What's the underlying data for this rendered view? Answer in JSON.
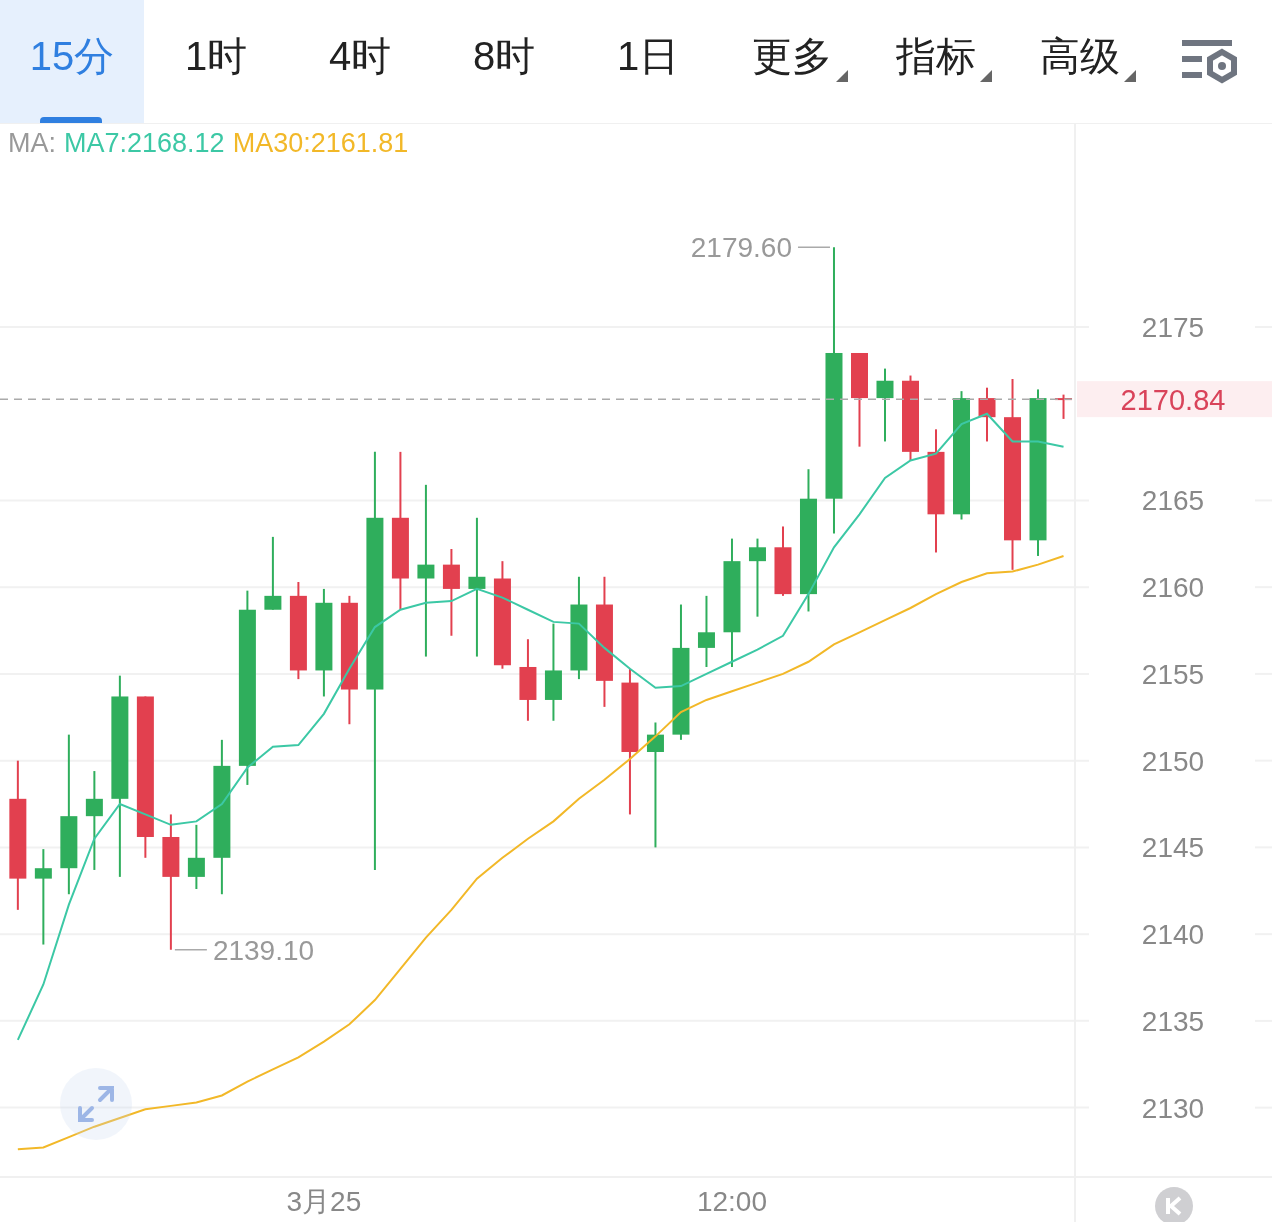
{
  "tabs": [
    {
      "label": "15分",
      "selected": true,
      "dropdown": false
    },
    {
      "label": "1时",
      "selected": false,
      "dropdown": false
    },
    {
      "label": "4时",
      "selected": false,
      "dropdown": false
    },
    {
      "label": "8时",
      "selected": false,
      "dropdown": false
    },
    {
      "label": "1日",
      "selected": false,
      "dropdown": false
    },
    {
      "label": "更多",
      "selected": false,
      "dropdown": true
    },
    {
      "label": "指标",
      "selected": false,
      "dropdown": true
    },
    {
      "label": "高级",
      "selected": false,
      "dropdown": true
    }
  ],
  "legend": {
    "prefix": "MA:",
    "items": [
      {
        "label": "MA7:2168.12",
        "color": "#3cc8a5"
      },
      {
        "label": "MA30:2161.81",
        "color": "#f2b828"
      }
    ]
  },
  "chart": {
    "chart_data": {
      "type": "line",
      "grid": true,
      "ylim": [
        2126.0,
        2186.7
      ],
      "yticks": [
        2130,
        2135,
        2140,
        2145,
        2150,
        2155,
        2160,
        2165,
        2175
      ],
      "categories": [
        null,
        null,
        null,
        null,
        null,
        null,
        null,
        null,
        null,
        null,
        null,
        null,
        "3月25",
        null,
        null,
        null,
        null,
        null,
        null,
        null,
        null,
        null,
        null,
        null,
        null,
        null,
        null,
        null,
        "12:00",
        null,
        null,
        null,
        null,
        null,
        null,
        null,
        null,
        null,
        null,
        null,
        null,
        null
      ],
      "series": [
        {
          "color": "#3cc8a5",
          "values": [
            2133.9,
            2137.1,
            2141.7,
            2145.5,
            2147.5,
            2146.9,
            2146.3,
            2146.5,
            2147.5,
            2149.6,
            2150.8,
            2150.9,
            2152.7,
            2155.3,
            2157.7,
            2158.7,
            2159.1,
            2159.2,
            2159.9,
            2159.4,
            2158.7,
            2158.0,
            2157.9,
            2156.5,
            2155.3,
            2154.2,
            2154.3,
            2155.0,
            2155.7,
            2156.4,
            2157.2,
            2159.6,
            2162.3,
            2164.2,
            2166.3,
            2167.3,
            2167.7,
            2169.4,
            2170.0,
            2168.4,
            2168.4,
            2168.1
          ]
        },
        {
          "color": "#f2b828",
          "values": [
            2127.6,
            2127.7,
            2128.3,
            2128.9,
            2129.4,
            2129.9,
            2130.1,
            2130.3,
            2130.7,
            2131.5,
            2132.2,
            2132.9,
            2133.8,
            2134.8,
            2136.2,
            2138.0,
            2139.8,
            2141.4,
            2143.2,
            2144.4,
            2145.5,
            2146.5,
            2147.8,
            2148.9,
            2150.1,
            2151.4,
            2152.8,
            2153.5,
            2154.0,
            2154.5,
            2155.0,
            2155.7,
            2156.7,
            2157.4,
            2158.1,
            2158.8,
            2159.6,
            2160.3,
            2160.8,
            2160.9,
            2161.3,
            2161.8
          ]
        },
        {
          "type": "candlestick",
          "ohlc": [
            [
              2147.8,
              2150.0,
              2141.4,
              2143.2
            ],
            [
              2143.2,
              2144.9,
              2139.4,
              2143.8
            ],
            [
              2143.8,
              2151.5,
              2142.3,
              2146.8
            ],
            [
              2146.8,
              2149.4,
              2143.7,
              2147.8
            ],
            [
              2147.8,
              2154.9,
              2143.3,
              2153.7
            ],
            [
              2153.7,
              2153.7,
              2144.4,
              2145.6
            ],
            [
              2145.6,
              2146.9,
              2139.1,
              2143.3
            ],
            [
              2143.3,
              2146.3,
              2142.6,
              2144.4
            ],
            [
              2144.4,
              2151.2,
              2142.3,
              2149.7
            ],
            [
              2149.7,
              2159.8,
              2148.6,
              2158.7
            ],
            [
              2158.7,
              2162.9,
              2158.7,
              2159.5
            ],
            [
              2159.5,
              2160.3,
              2154.7,
              2155.2
            ],
            [
              2155.2,
              2159.9,
              2153.7,
              2159.1
            ],
            [
              2159.1,
              2159.5,
              2152.1,
              2154.1
            ],
            [
              2154.1,
              2167.8,
              2143.7,
              2164.0
            ],
            [
              2164.0,
              2167.8,
              2158.7,
              2160.5
            ],
            [
              2160.5,
              2165.9,
              2156.0,
              2161.3
            ],
            [
              2161.3,
              2162.2,
              2157.2,
              2159.9
            ],
            [
              2159.9,
              2164.0,
              2156.0,
              2160.6
            ],
            [
              2160.5,
              2161.5,
              2155.3,
              2155.5
            ],
            [
              2155.4,
              2157.0,
              2152.3,
              2153.5
            ],
            [
              2153.5,
              2157.9,
              2152.3,
              2155.2
            ],
            [
              2155.2,
              2160.6,
              2154.7,
              2159.0
            ],
            [
              2159.0,
              2160.6,
              2153.1,
              2154.6
            ],
            [
              2154.5,
              2155.3,
              2146.9,
              2150.5
            ],
            [
              2150.5,
              2152.2,
              2145.0,
              2151.5
            ],
            [
              2151.5,
              2159.0,
              2151.2,
              2156.5
            ],
            [
              2156.5,
              2159.5,
              2155.4,
              2157.4
            ],
            [
              2157.4,
              2162.8,
              2155.4,
              2161.5
            ],
            [
              2161.5,
              2162.8,
              2158.3,
              2162.3
            ],
            [
              2162.3,
              2163.5,
              2159.5,
              2159.6
            ],
            [
              2159.6,
              2166.8,
              2158.6,
              2165.1
            ],
            [
              2165.1,
              2179.6,
              2163.1,
              2173.5
            ],
            [
              2173.5,
              2173.5,
              2168.1,
              2170.9
            ],
            [
              2170.9,
              2172.6,
              2168.4,
              2171.9
            ],
            [
              2171.9,
              2172.2,
              2167.3,
              2167.8
            ],
            [
              2167.8,
              2169.1,
              2162.0,
              2164.2
            ],
            [
              2164.2,
              2171.3,
              2163.9,
              2170.9
            ],
            [
              2170.9,
              2171.5,
              2168.4,
              2169.8
            ],
            [
              2169.8,
              2172.0,
              2161.0,
              2162.7
            ],
            [
              2162.7,
              2171.4,
              2161.8,
              2170.9
            ],
            [
              2170.9,
              2171.1,
              2169.7,
              2170.84
            ]
          ]
        }
      ],
      "ref_lines": [
        {
          "axis": "y",
          "value": 2170.84,
          "label": "2170.84"
        }
      ],
      "annotations": [
        "2179.60",
        "2139.10"
      ]
    }
  }
}
